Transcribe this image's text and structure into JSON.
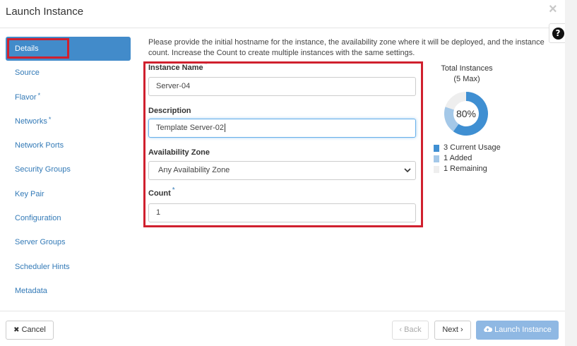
{
  "window": {
    "title": "Launch Instance",
    "close_icon": "×",
    "help_icon": "?"
  },
  "nav": {
    "items": [
      {
        "label": "Details",
        "required": false,
        "active": true
      },
      {
        "label": "Source",
        "required": false
      },
      {
        "label": "Flavor",
        "required": true
      },
      {
        "label": "Networks",
        "required": true
      },
      {
        "label": "Network Ports",
        "required": false
      },
      {
        "label": "Security Groups",
        "required": false
      },
      {
        "label": "Key Pair",
        "required": false
      },
      {
        "label": "Configuration",
        "required": false
      },
      {
        "label": "Server Groups",
        "required": false
      },
      {
        "label": "Scheduler Hints",
        "required": false
      },
      {
        "label": "Metadata",
        "required": false
      }
    ],
    "required_marker": "*"
  },
  "details": {
    "intro": "Please provide the initial hostname for the instance, the availability zone where it will be deployed, and the instance count. Increase the Count to create multiple instances with the same settings.",
    "instance_name": {
      "label": "Instance Name",
      "value": "Server-04",
      "required_marker": "*"
    },
    "description": {
      "label": "Description",
      "value": "Template Server-02"
    },
    "availability_zone": {
      "label": "Availability Zone",
      "selected": "Any Availability Zone"
    },
    "count": {
      "label": "Count",
      "value": "1",
      "required_marker": "*"
    }
  },
  "quota": {
    "title": "Total Instances",
    "subtitle": "(5 Max)",
    "percent_label": "80%",
    "max": 5,
    "current": 3,
    "added": 1,
    "remaining": 1,
    "legend": [
      {
        "label": "3 Current Usage",
        "color": "#3f8fd2"
      },
      {
        "label": "1 Added",
        "color": "#a4c8e8"
      },
      {
        "label": "1 Remaining",
        "color": "#eeeeee"
      }
    ]
  },
  "footer": {
    "cancel_label": "Cancel",
    "back_label": "Back",
    "next_label": "Next",
    "launch_label": "Launch Instance"
  },
  "colors": {
    "accent": "#428bca",
    "link": "#337ab7",
    "highlight_box": "#d0202e",
    "launch_button": "#8fb8e3"
  }
}
